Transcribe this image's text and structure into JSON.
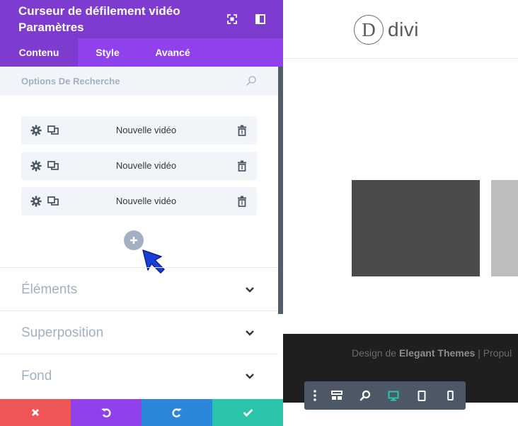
{
  "panel": {
    "title_line1": "Curseur de défilement vidéo",
    "title_line2": "Paramètres",
    "tabs": [
      {
        "label": "Contenu",
        "active": true
      },
      {
        "label": "Style",
        "active": false
      },
      {
        "label": "Avancé",
        "active": false
      }
    ],
    "search": {
      "placeholder": "Options De Recherche"
    },
    "items": [
      {
        "label": "Nouvelle vidéo"
      },
      {
        "label": "Nouvelle vidéo"
      },
      {
        "label": "Nouvelle vidéo"
      }
    ],
    "toggles": [
      {
        "label": "Éléments"
      },
      {
        "label": "Superposition"
      },
      {
        "label": "Fond"
      }
    ]
  },
  "site": {
    "logo_letter": "D",
    "logo_text": "divi",
    "footer_prefix": "Design de ",
    "footer_brand": "Elegant Themes",
    "footer_suffix": " | Propul"
  },
  "colors": {
    "header": "#7e3bd0",
    "tabs": "#8f42ec",
    "cancel": "#ef5555",
    "undo": "#8f42ec",
    "redo": "#2b87da",
    "save": "#29c4a9",
    "footer_dark": "#1f1f1f",
    "toolbar": "#4c5866",
    "active_view": "#29c4a9"
  },
  "icons": {
    "header": [
      "fullscreen-icon",
      "sidebar-layout-icon"
    ],
    "item": [
      "gear-icon",
      "duplicate-icon",
      "trash-icon"
    ],
    "footer": [
      "close-icon",
      "undo-icon",
      "redo-icon",
      "check-icon"
    ],
    "view_toolbar": [
      "more-dots-icon",
      "layout-icon",
      "zoom-icon",
      "desktop-icon",
      "tablet-icon",
      "phone-icon"
    ]
  }
}
